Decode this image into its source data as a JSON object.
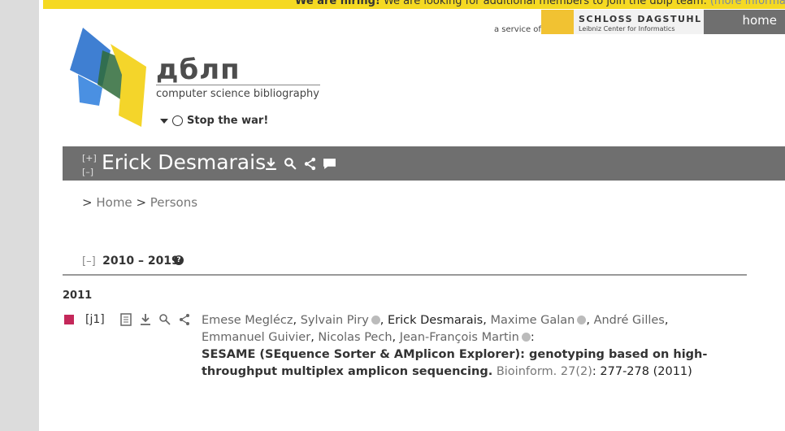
{
  "banner": {
    "lead": "We are hiring!",
    "text": "We are looking for additional members to join the dblp team.",
    "link": "(more information)"
  },
  "service": {
    "label": "a service of",
    "org_name": "SCHLOSS DAGSTUHL",
    "org_sub": "Leibniz Center for Informatics"
  },
  "nav": {
    "home": "home"
  },
  "logo": {
    "title": "дблп",
    "subtitle": "computer science bibliography"
  },
  "stopwar": {
    "label": "Stop the war!"
  },
  "header": {
    "expand": "[+]",
    "collapse": "[–]",
    "name": "Erick Desmarais"
  },
  "breadcrumb": {
    "sep1": ">",
    "home": "Home",
    "sep2": ">",
    "persons": "Persons"
  },
  "section": {
    "toggle": "[–]",
    "title": "2010 – 2019",
    "help": "?"
  },
  "year": "2011",
  "publication": {
    "key": "[j1]",
    "authors": [
      {
        "name": "Emese Meglécz",
        "orcid": false,
        "sep": ","
      },
      {
        "name": "Sylvain Piry",
        "orcid": true,
        "sep": ","
      },
      {
        "name": "Erick Desmarais",
        "orcid": false,
        "sep": ",",
        "self": true
      },
      {
        "name": "Maxime Galan",
        "orcid": true,
        "sep": ","
      },
      {
        "name": "André Gilles",
        "orcid": false,
        "sep": ","
      },
      {
        "name": "Emmanuel Guivier",
        "orcid": false,
        "sep": ","
      },
      {
        "name": "Nicolas Pech",
        "orcid": false,
        "sep": ","
      },
      {
        "name": "Jean-François Martin",
        "orcid": true,
        "sep": ":"
      }
    ],
    "title": "SESAME (SEquence Sorter & AMplicon Explorer): genotyping based on high-throughput multiplex amplicon sequencing.",
    "venue": "Bioinform. 27(2)",
    "pages": ": 277-278 (2011)"
  },
  "colors": {
    "banner": "#f5d922",
    "header_bar": "#6f6f6f",
    "pubtype_journal": "#c4285a"
  }
}
